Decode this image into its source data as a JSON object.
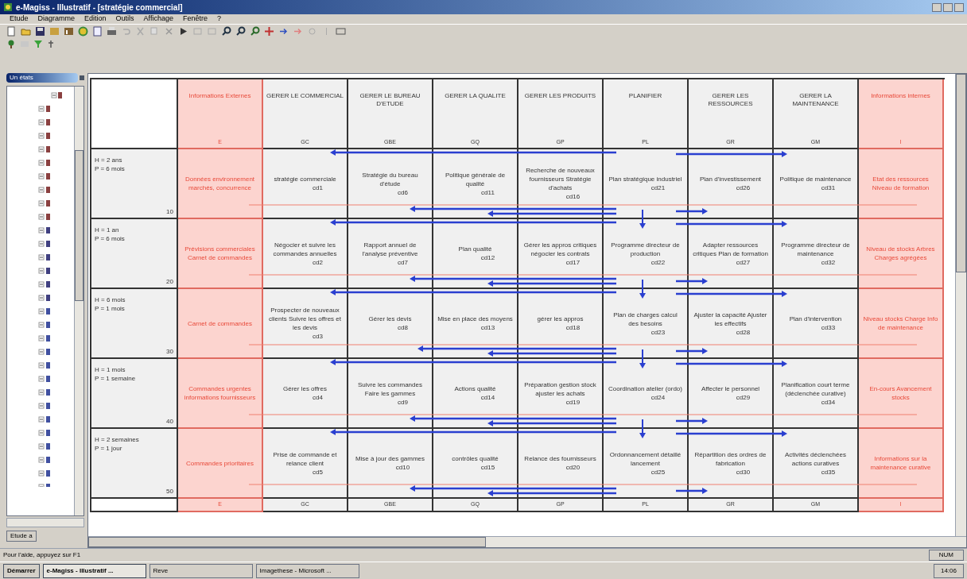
{
  "window": {
    "title": "e-Magiss - Illustratif - [stratégie commercial]"
  },
  "menu": [
    "Etude",
    "Diagramme",
    "Edition",
    "Outils",
    "Affichage",
    "Fenêtre",
    "?"
  ],
  "panel": {
    "title": "Un états",
    "tab": "Etude a"
  },
  "columns": [
    {
      "kind": "external",
      "label": "Informations Externes",
      "code": "E"
    },
    {
      "kind": "process",
      "label": "GERER LE COMMERCIAL",
      "code": "GC"
    },
    {
      "kind": "process",
      "label": "GERER LE BUREAU D'ETUDE",
      "code": "GBE"
    },
    {
      "kind": "process",
      "label": "GERER LA QUALITE",
      "code": "GQ"
    },
    {
      "kind": "process",
      "label": "GERER LES PRODUITS",
      "code": "GP"
    },
    {
      "kind": "process",
      "label": "PLANIFIER",
      "code": "PL"
    },
    {
      "kind": "process",
      "label": "GERER LES RESSOURCES",
      "code": "GR"
    },
    {
      "kind": "process",
      "label": "GERER LA MAINTENANCE",
      "code": "GM"
    },
    {
      "kind": "internal",
      "label": "Informations internes",
      "code": "I"
    }
  ],
  "rows": [
    {
      "horizon": "H = 2 ans",
      "period": "P = 6 mois",
      "number": "10",
      "cells": [
        {
          "text": "Données environnement marchés, concurrence"
        },
        {
          "text": "stratégie commerciale",
          "code": "cd1"
        },
        {
          "text": "Stratégie du bureau d'étude",
          "code": "cd6"
        },
        {
          "text": "Politique générale de qualité",
          "code": "cd11"
        },
        {
          "text": "Recherche de nouveaux fournisseurs Stratégie d'achats",
          "code": "cd16"
        },
        {
          "text": "Plan stratégique industriel",
          "code": "cd21"
        },
        {
          "text": "Plan d'investissement",
          "code": "cd26"
        },
        {
          "text": "Politique de maintenance",
          "code": "cd31"
        },
        {
          "text": "Etat des ressources Niveau de formation"
        }
      ]
    },
    {
      "horizon": "H = 1 an",
      "period": "P = 6 mois",
      "number": "20",
      "cells": [
        {
          "text": "Prévisions commerciales Carnet de commandes"
        },
        {
          "text": "Négocier et suivre les commandes annuelles",
          "code": "cd2"
        },
        {
          "text": "Rapport annuel de l'analyse préventive",
          "code": "cd7"
        },
        {
          "text": "Plan qualité",
          "code": "cd12"
        },
        {
          "text": "Gérer les appros critiques négocier les contrats",
          "code": "cd17"
        },
        {
          "text": "Programme directeur de production",
          "code": "cd22"
        },
        {
          "text": "Adapter ressources critiques Plan de formation",
          "code": "cd27"
        },
        {
          "text": "Programme directeur de maintenance",
          "code": "cd32"
        },
        {
          "text": "Niveau de stocks Arbres Charges agrégées"
        }
      ]
    },
    {
      "horizon": "H = 6 mois",
      "period": "P = 1 mois",
      "number": "30",
      "cells": [
        {
          "text": "Carnet de commandes"
        },
        {
          "text": "Prospecter de nouveaux clients Suivre les offres et les devis",
          "code": "cd3"
        },
        {
          "text": "Gérer les devis",
          "code": "cd8"
        },
        {
          "text": "Mise en place des moyens",
          "code": "cd13"
        },
        {
          "text": "gérer les appros",
          "code": "cd18"
        },
        {
          "text": "Plan de charges calcul des besoins",
          "code": "cd23"
        },
        {
          "text": "Ajuster la capacité Ajuster les effectifs",
          "code": "cd28"
        },
        {
          "text": "Plan d'intervention",
          "code": "cd33"
        },
        {
          "text": "Niveau stocks Charge Info de maintenance"
        }
      ]
    },
    {
      "horizon": "H = 1 mois",
      "period": "P = 1 semaine",
      "number": "40",
      "cells": [
        {
          "text": "Commandes urgentes informations fournisseurs"
        },
        {
          "text": "Gérer les offres",
          "code": "cd4"
        },
        {
          "text": "Suivre les commandes Faire les gammes",
          "code": "cd9"
        },
        {
          "text": "Actions qualité",
          "code": "cd14"
        },
        {
          "text": "Préparation gestion stock ajuster les achats",
          "code": "cd19"
        },
        {
          "text": "Coordination atelier (ordo)",
          "code": "cd24"
        },
        {
          "text": "Affecter le personnel",
          "code": "cd29"
        },
        {
          "text": "Planification court terme (déclenchée curative)",
          "code": "cd34"
        },
        {
          "text": "En-cours Avancement stocks"
        }
      ]
    },
    {
      "horizon": "H = 2 semaines",
      "period": "P = 1 jour",
      "number": "50",
      "cells": [
        {
          "text": "Commandes prioritaires"
        },
        {
          "text": "Prise de commande et relance client",
          "code": "cd5"
        },
        {
          "text": "Mise à jour des gammes",
          "code": "cd10"
        },
        {
          "text": "contrôles qualité",
          "code": "cd15"
        },
        {
          "text": "Relance des fournisseurs",
          "code": "cd20"
        },
        {
          "text": "Ordonnancement détaillé lancement",
          "code": "cd25"
        },
        {
          "text": "Répartition des ordres de fabrication",
          "code": "cd30"
        },
        {
          "text": "Activités déclenchées actions curatives",
          "code": "cd35"
        },
        {
          "text": "Informations sur la maintenance curative"
        }
      ]
    }
  ],
  "footer": [
    "E",
    "GC",
    "GBE",
    "GQ",
    "GP",
    "PL",
    "GR",
    "GM",
    "I"
  ],
  "status_bar": {
    "text": "Pour l'aide, appuyez sur F1",
    "indicator": "NUM"
  },
  "taskbar": {
    "start": "Démarrer",
    "items": [
      {
        "label": "e-Magiss - Illustratif ...",
        "selected": true
      },
      {
        "label": "Reve",
        "selected": false
      },
      {
        "label": "Imagethese - Microsoft ...",
        "selected": false
      }
    ],
    "clock": "14:06"
  }
}
